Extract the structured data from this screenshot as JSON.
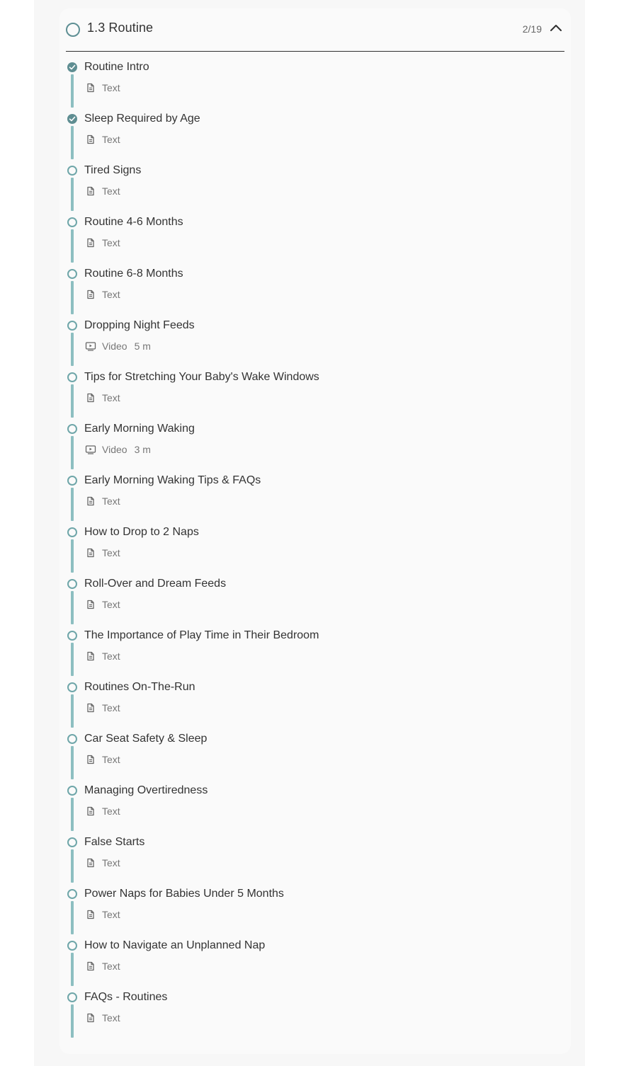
{
  "section": {
    "title": "1.3 Routine",
    "progress": "2/19",
    "expanded": true
  },
  "colors": {
    "accent": "#5f8e92",
    "rail": "#8dbfc1"
  },
  "lessons": [
    {
      "title": "Routine Intro",
      "type": "Text",
      "duration": "",
      "icon": "document-icon",
      "completed": true
    },
    {
      "title": "Sleep Required by Age",
      "type": "Text",
      "duration": "",
      "icon": "document-icon",
      "completed": true
    },
    {
      "title": "Tired Signs",
      "type": "Text",
      "duration": "",
      "icon": "document-icon",
      "completed": false
    },
    {
      "title": "Routine 4-6 Months",
      "type": "Text",
      "duration": "",
      "icon": "document-icon",
      "completed": false
    },
    {
      "title": "Routine 6-8 Months",
      "type": "Text",
      "duration": "",
      "icon": "document-icon",
      "completed": false
    },
    {
      "title": "Dropping Night Feeds",
      "type": "Video",
      "duration": "5 m",
      "icon": "video-icon",
      "completed": false
    },
    {
      "title": "Tips for Stretching Your Baby's Wake Windows",
      "type": "Text",
      "duration": "",
      "icon": "document-icon",
      "completed": false
    },
    {
      "title": "Early Morning Waking",
      "type": "Video",
      "duration": "3 m",
      "icon": "video-icon",
      "completed": false
    },
    {
      "title": "Early Morning Waking Tips & FAQs",
      "type": "Text",
      "duration": "",
      "icon": "document-icon",
      "completed": false
    },
    {
      "title": "How to Drop to 2 Naps",
      "type": "Text",
      "duration": "",
      "icon": "document-icon",
      "completed": false
    },
    {
      "title": "Roll-Over and Dream Feeds",
      "type": "Text",
      "duration": "",
      "icon": "document-icon",
      "completed": false
    },
    {
      "title": "The Importance of Play Time in Their Bedroom",
      "type": "Text",
      "duration": "",
      "icon": "document-icon",
      "completed": false
    },
    {
      "title": "Routines On-The-Run",
      "type": "Text",
      "duration": "",
      "icon": "document-icon",
      "completed": false
    },
    {
      "title": "Car Seat Safety & Sleep",
      "type": "Text",
      "duration": "",
      "icon": "document-icon",
      "completed": false
    },
    {
      "title": "Managing Overtiredness",
      "type": "Text",
      "duration": "",
      "icon": "document-icon",
      "completed": false
    },
    {
      "title": "False Starts",
      "type": "Text",
      "duration": "",
      "icon": "document-icon",
      "completed": false
    },
    {
      "title": "Power Naps for Babies Under 5 Months",
      "type": "Text",
      "duration": "",
      "icon": "document-icon",
      "completed": false
    },
    {
      "title": "How to Navigate an Unplanned Nap",
      "type": "Text",
      "duration": "",
      "icon": "document-icon",
      "completed": false
    },
    {
      "title": "FAQs - Routines",
      "type": "Text",
      "duration": "",
      "icon": "document-icon",
      "completed": false
    }
  ]
}
